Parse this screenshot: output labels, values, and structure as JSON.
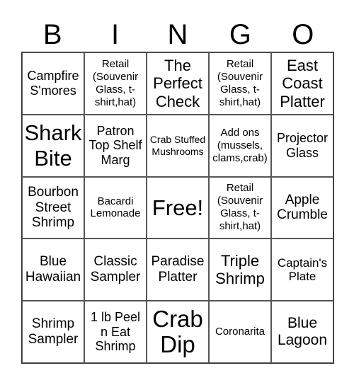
{
  "header": [
    "B",
    "I",
    "N",
    "G",
    "O"
  ],
  "cells": [
    [
      "Campfire S'mores",
      "Retail (Souvenir Glass, t-shirt,hat)",
      "The Perfect Check",
      "Retail (Souvenir Glass, t-shirt,hat)",
      "East Coast Platter"
    ],
    [
      "Shark Bite",
      "Patron Top Shelf Marg",
      "Crab Stuffed Mushrooms",
      "Add ons (mussels, clams,crab)",
      "Projector Glass"
    ],
    [
      "Bourbon Street Shrimp",
      "Bacardi Lemonade",
      "Free!",
      "Retail (Souvenir Glass, t-shirt,hat)",
      "Apple Crumble"
    ],
    [
      "Blue Hawaiian",
      "Classic Sampler",
      "Paradise Platter",
      "Triple Shrimp",
      "Captain's Plate"
    ],
    [
      "Shrimp Sampler",
      "1 lb Peel n Eat Shrimp",
      "Crab Dip",
      "Coronarita",
      "Blue Lagoon"
    ]
  ]
}
